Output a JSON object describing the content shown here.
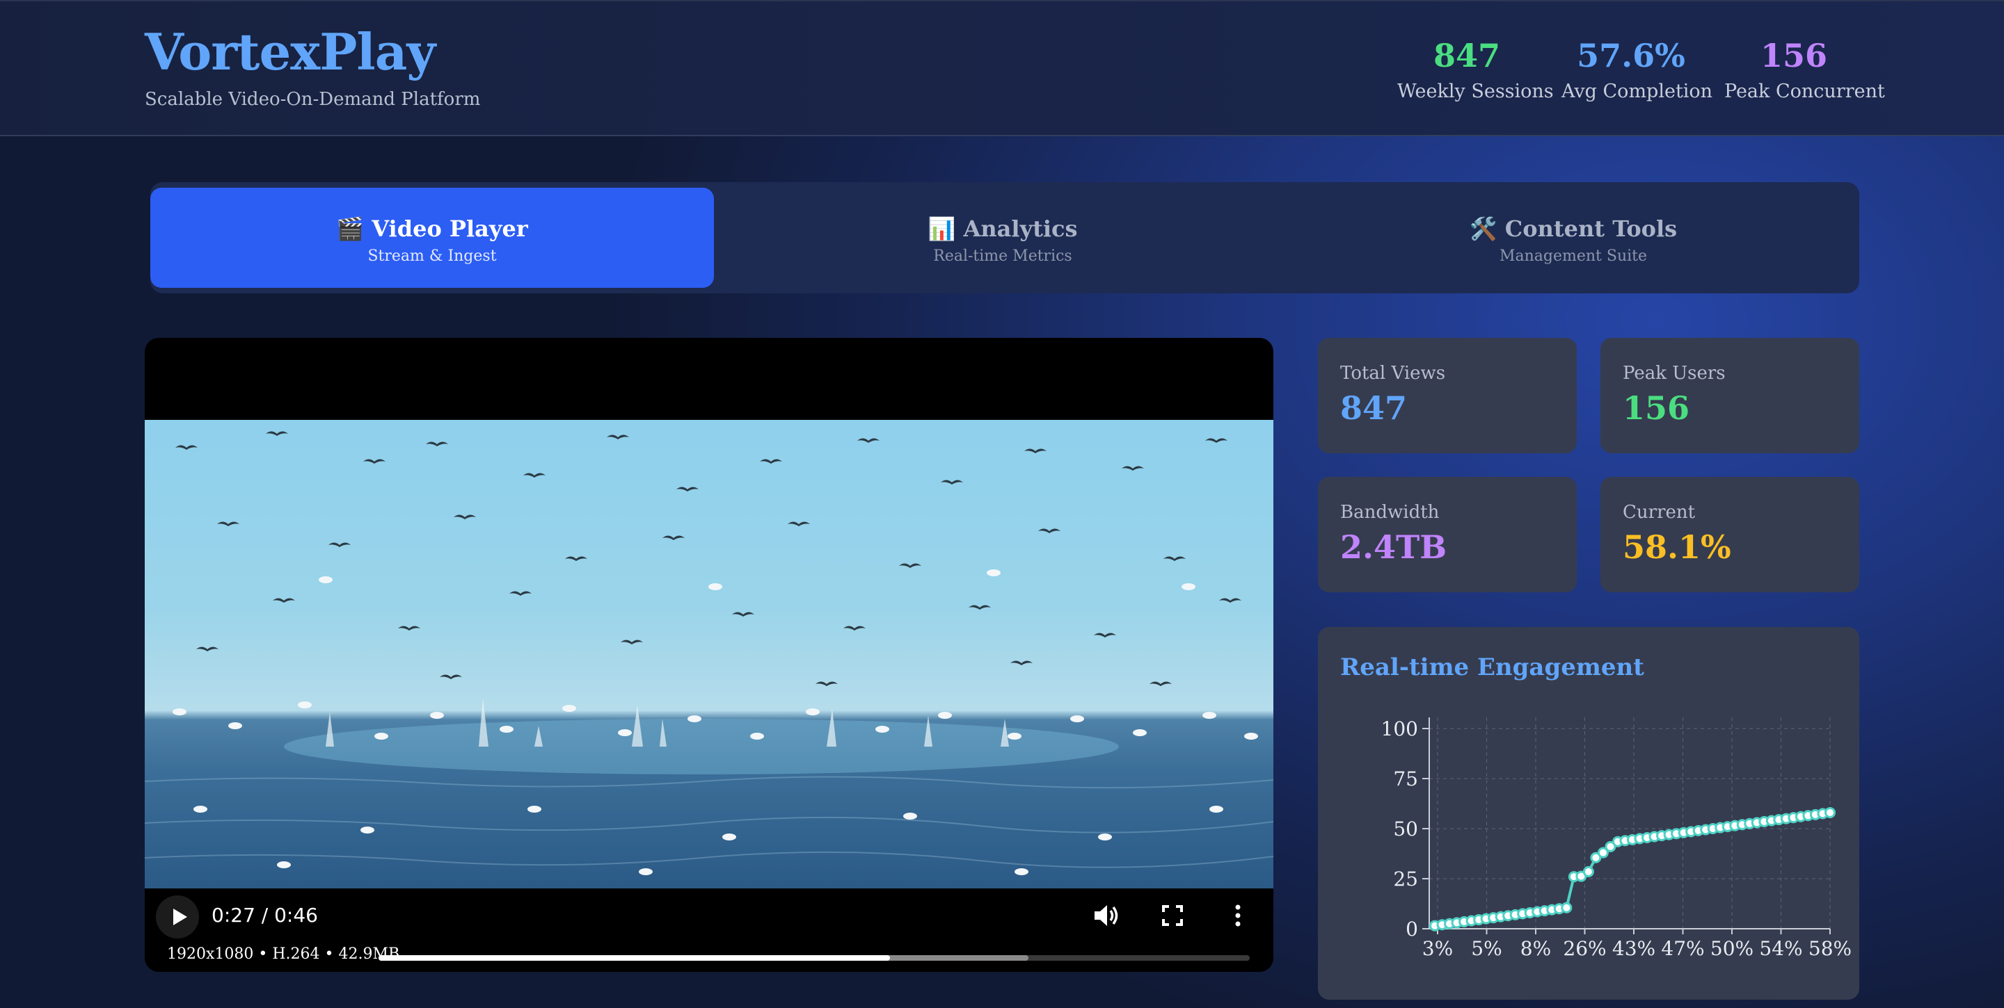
{
  "app": {
    "name": "VortexPlay",
    "tagline": "Scalable Video-On-Demand Platform"
  },
  "header_stats": [
    {
      "value": "847",
      "label": "Weekly Sessions",
      "color": "#4ade80"
    },
    {
      "value": "57.6%",
      "label": "Avg Completion",
      "color": "#60a5fa"
    },
    {
      "value": "156",
      "label": "Peak Concurrent",
      "color": "#c084fc"
    }
  ],
  "tabs": [
    {
      "icon": "🎬",
      "title": "Video Player",
      "subtitle": "Stream & Ingest",
      "active": true
    },
    {
      "icon": "📊",
      "title": "Analytics",
      "subtitle": "Real-time Metrics",
      "active": false
    },
    {
      "icon": "🛠️",
      "title": "Content Tools",
      "subtitle": "Management Suite",
      "active": false
    }
  ],
  "player": {
    "time": "0:27 / 0:46",
    "meta": "1920x1080 • H.264 • 42.9MB",
    "played_fraction": 0.587,
    "buffered_fraction": 0.746
  },
  "metrics": [
    {
      "label": "Total Views",
      "value": "847",
      "color": "#60a5fa"
    },
    {
      "label": "Peak Users",
      "value": "156",
      "color": "#4ade80"
    },
    {
      "label": "Bandwidth",
      "value": "2.4TB",
      "color": "#c084fc"
    },
    {
      "label": "Current",
      "value": "58.1%",
      "color": "#fbbf24"
    }
  ],
  "engagement": {
    "title": "Real-time Engagement",
    "chart_data": {
      "type": "line",
      "xlabel": "",
      "ylabel": "",
      "ylim": [
        0,
        100
      ],
      "yticks": [
        0,
        25,
        50,
        75,
        100
      ],
      "xtick_labels": [
        "3%",
        "5%",
        "8%",
        "26%",
        "43%",
        "47%",
        "50%",
        "54%",
        "58%"
      ],
      "grid": true,
      "color": "#4fd1c5",
      "values": [
        1.5,
        2.0,
        2.5,
        3.0,
        3.5,
        4.0,
        4.5,
        5.0,
        5.5,
        6.0,
        6.5,
        7.0,
        7.5,
        8.0,
        8.5,
        9.0,
        9.5,
        10.0,
        10.5,
        26.0,
        26.2,
        28.5,
        35.5,
        38.0,
        41.0,
        43.5,
        44.0,
        44.5,
        45.0,
        45.5,
        46.0,
        46.5,
        47.0,
        47.5,
        48.0,
        48.5,
        49.0,
        49.5,
        50.0,
        50.5,
        51.0,
        51.5,
        52.0,
        52.5,
        53.0,
        53.5,
        54.0,
        54.5,
        55.0,
        55.5,
        56.0,
        56.5,
        57.0,
        57.5,
        58.0
      ]
    }
  }
}
